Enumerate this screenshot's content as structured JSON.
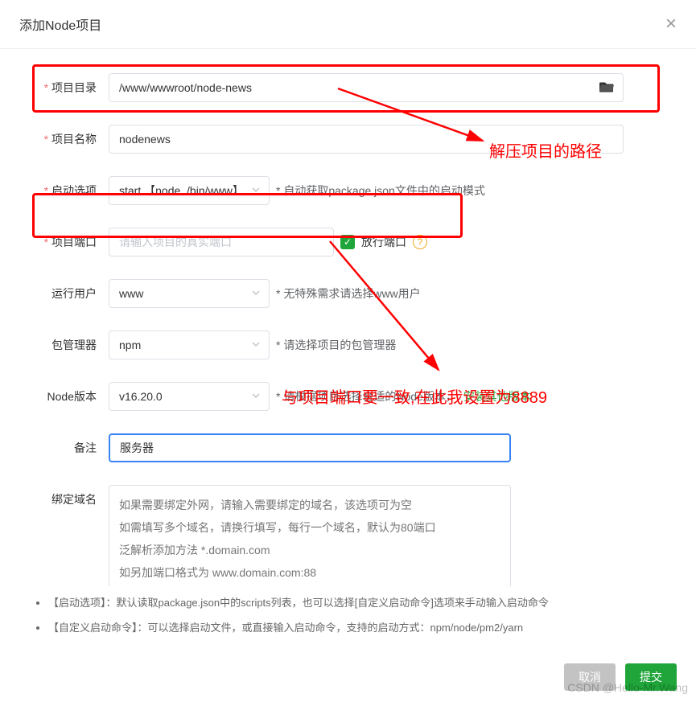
{
  "modal": {
    "title": "添加Node项目",
    "close": "×"
  },
  "form": {
    "dir": {
      "label": "项目目录",
      "value": "/www/wwwroot/node-news"
    },
    "name": {
      "label": "项目名称",
      "value": "nodenews"
    },
    "start": {
      "label": "启动选项",
      "value": "start 【node ./bin/www】",
      "hint": "* 自动获取package.json文件中的启动模式"
    },
    "port": {
      "label": "项目端口",
      "placeholder": "请输入项目的真实端口",
      "allow_label": "放行端口"
    },
    "user": {
      "label": "运行用户",
      "value": "www",
      "hint": "* 无特殊需求请选择www用户"
    },
    "pkg": {
      "label": "包管理器",
      "value": "npm",
      "hint": "* 请选择项目的包管理器"
    },
    "node": {
      "label": "Node版本",
      "value": "v16.20.0",
      "hint": "* 请根据项目选择合适的Node版本，",
      "link": "安装其他版本"
    },
    "remark": {
      "label": "备注",
      "value": "服务器"
    },
    "domain": {
      "label": "绑定域名",
      "placeholder": "如果需要绑定外网，请输入需要绑定的域名，该选项可为空\n如需填写多个域名，请换行填写，每行一个域名，默认为80端口\n泛解析添加方法 *.domain.com\n如另加端口格式为 www.domain.com:88"
    }
  },
  "tips": {
    "t1": "【启动选项】：默认读取package.json中的scripts列表，也可以选择[自定义启动命令]选项来手动输入启动命令",
    "t2": "【自定义启动命令】：可以选择启动文件，或直接输入启动命令，支持的启动方式：npm/node/pm2/yarn"
  },
  "buttons": {
    "cancel": "取消",
    "submit": "提交"
  },
  "annotations": {
    "a1": "解压项目的路径",
    "a2": "与项目端口要一致,在此我设置为8889"
  },
  "watermark": "CSDN @Hello-Mr.Wang"
}
